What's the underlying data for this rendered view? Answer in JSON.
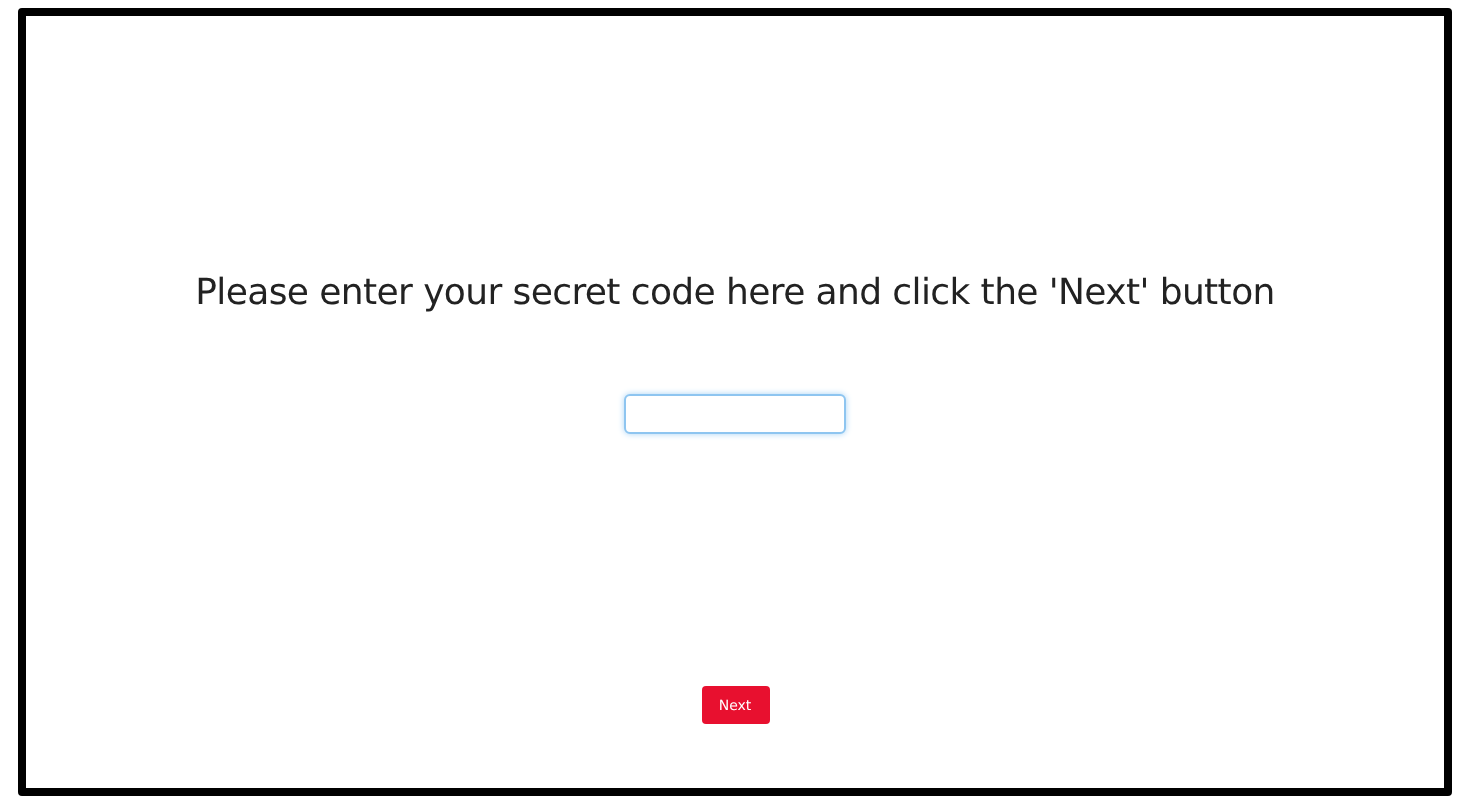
{
  "prompt": "Please enter your secret code here and click the 'Next' button",
  "buttons": [
    {
      "label": "Next",
      "kind": "primary"
    }
  ]
}
